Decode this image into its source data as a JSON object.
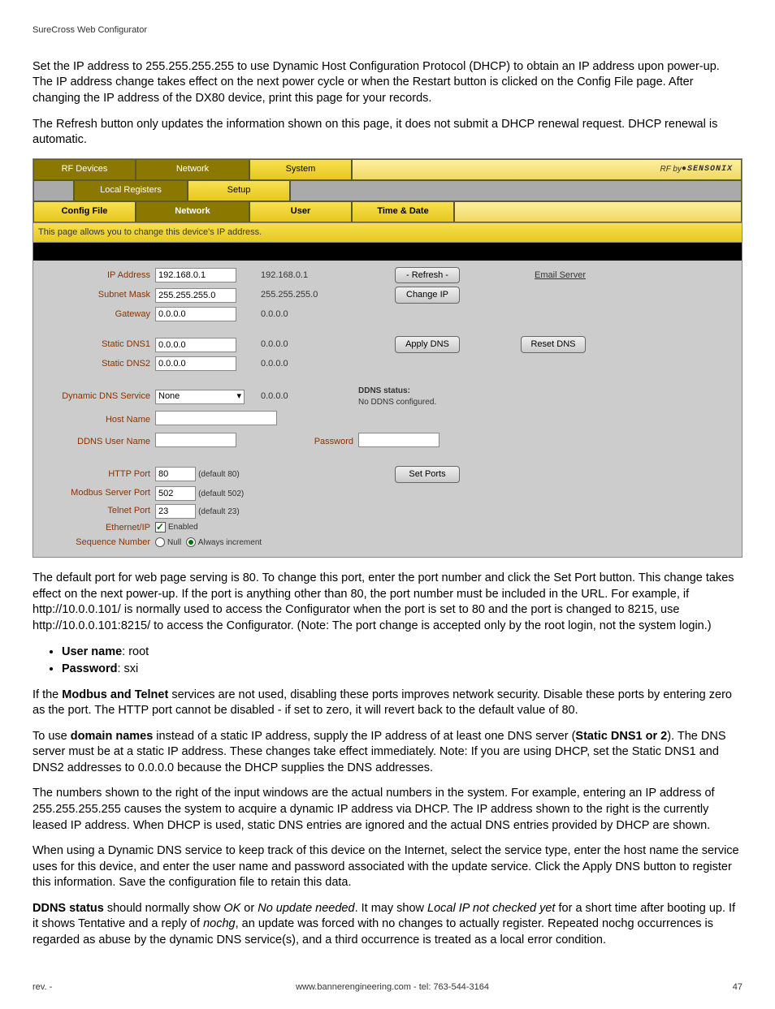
{
  "header_small": "SureCross Web Configurator",
  "paragraphs": {
    "p1": "Set the IP address to 255.255.255.255 to use Dynamic Host Configuration Protocol (DHCP) to obtain an IP address upon power-up. The IP address change takes effect on the next power cycle or when the Restart button is clicked on the Config File page. After changing the IP address of the DX80 device, print this page for your records.",
    "p2": "The Refresh button only updates the information shown on this page, it does not submit a DHCP renewal request. DHCP renewal is automatic."
  },
  "panel": {
    "tabs_row1": {
      "rf_devices": "RF Devices",
      "network": "Network",
      "system": "System",
      "brand_prefix": "RF by ",
      "brand": "●SENSONIX"
    },
    "tabs_row2": {
      "local_registers": "Local Registers",
      "setup": "Setup"
    },
    "tabs_row3": {
      "config_file": "Config File",
      "network": "Network",
      "user": "User",
      "time_date": "Time & Date"
    },
    "desc": "This page allows you to change this device's IP address.",
    "rows": {
      "ip": {
        "label": "IP Address",
        "input": "192.168.0.1",
        "display": "192.168.0.1",
        "btn_refresh": "- Refresh -",
        "link_email": "Email Server"
      },
      "subnet": {
        "label": "Subnet Mask",
        "input": "255.255.255.0",
        "display": "255.255.255.0",
        "btn_change": "Change IP"
      },
      "gateway": {
        "label": "Gateway",
        "input": "0.0.0.0",
        "display": "0.0.0.0"
      },
      "dns1": {
        "label": "Static DNS1",
        "input": "0.0.0.0",
        "display": "0.0.0.0",
        "btn_apply": "Apply DNS",
        "btn_reset": "Reset DNS"
      },
      "dns2": {
        "label": "Static DNS2",
        "input": "0.0.0.0",
        "display": "0.0.0.0"
      },
      "ddns_service": {
        "label": "Dynamic DNS Service",
        "input": "None",
        "display": "0.0.0.0",
        "status_label": "DDNS status:",
        "status_value": "No DDNS configured."
      },
      "hostname": {
        "label": "Host Name"
      },
      "ddns_user": {
        "label": "DDNS User Name",
        "password_label": "Password"
      },
      "http_port": {
        "label": "HTTP Port",
        "input": "80",
        "default": "(default 80)",
        "btn_set": "Set Ports"
      },
      "modbus_port": {
        "label": "Modbus Server Port",
        "input": "502",
        "default": "(default 502)"
      },
      "telnet_port": {
        "label": "Telnet Port",
        "input": "23",
        "default": "(default 23)"
      },
      "ethernet_ip": {
        "label": "Ethernet/IP",
        "enabled": "Enabled"
      },
      "sequence": {
        "label": "Sequence Number",
        "null_opt": "Null",
        "always_opt": "Always increment"
      }
    }
  },
  "post": {
    "p3": "The default port for web page serving is 80. To change this port, enter the port number and click the Set Port button. This change takes effect on the next power-up. If the port is anything other than 80, the port number must be included in the URL. For example, if http://10.0.0.101/ is normally used to access the Configurator when the port is set to 80 and the port is changed to 8215, use http://10.0.0.101:8215/ to access the Configurator. (Note: The port change is accepted only by the root login, not the system login.)",
    "creds": {
      "user_label": "User name",
      "user_val": ": root",
      "pass_label": "Password",
      "pass_val": ": sxi"
    },
    "p4a": "If the ",
    "p4b": "Modbus and Telnet",
    "p4c": " services are not used, disabling these ports improves network security. Disable these ports by entering zero as the port. The HTTP port cannot be disabled - if set to zero, it will revert back to the default value of 80.",
    "p5a": "To use ",
    "p5b": "domain names",
    "p5c": " instead of a static IP address, supply the IP address of at least one DNS server (",
    "p5d": "Static DNS1 or 2",
    "p5e": "). The DNS server must be at a static IP address. These changes take effect immediately. Note: If you are using DHCP, set the Static DNS1 and DNS2 addresses to 0.0.0.0 because the DHCP supplies the DNS addresses.",
    "p6": "The numbers shown to the right of the input windows are the actual numbers in the system. For example, entering an IP address of 255.255.255.255 causes the system to acquire a dynamic IP address via DHCP. The IP address shown to the right is the currently leased IP address. When DHCP is used, static DNS entries are ignored and the actual DNS entries provided by DHCP are shown.",
    "p7": "When using a Dynamic DNS service to keep track of this device on the Internet, select the service type, enter the host name the service uses for this device, and enter the user name and password associated with the update service. Click the Apply DNS button to register this information. Save the configuration file to retain this data.",
    "p8a": "DDNS status",
    "p8b": " should normally show ",
    "p8c": "OK",
    "p8d": " or ",
    "p8e": "No update needed",
    "p8f": ". It may show ",
    "p8g": "Local IP not checked yet",
    "p8h": " for a short time after booting up. If it shows Tentative and a reply of ",
    "p8i": "nochg",
    "p8j": ", an update was forced with no changes to actually register. Repeated nochg occurrences is regarded as abuse by the dynamic DNS service(s), and a third occurrence is treated as a local error condition."
  },
  "footer": {
    "rev": "rev. -",
    "url": "www.bannerengineering.com - tel: 763-544-3164",
    "page": "47"
  }
}
